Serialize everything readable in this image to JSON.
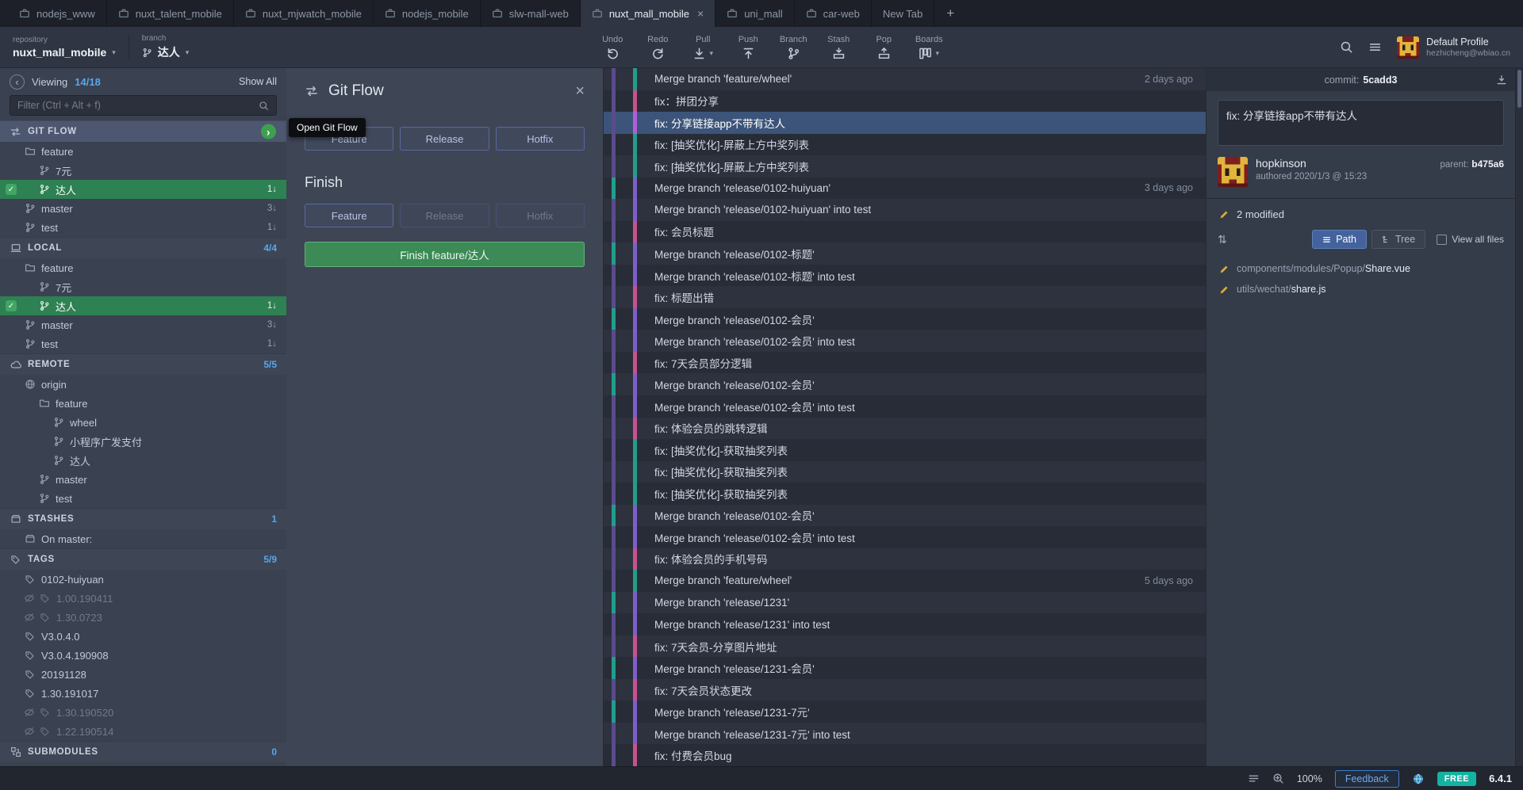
{
  "icons": {
    "check": "✓",
    "chevron_right": "›",
    "collapse": "‹",
    "close": "×",
    "caret": "▾",
    "sort": "⇅",
    "add_tab": "+"
  },
  "tabs": [
    {
      "label": "nodejs_www"
    },
    {
      "label": "nuxt_talent_mobile"
    },
    {
      "label": "nuxt_mjwatch_mobile"
    },
    {
      "label": "nodejs_mobile"
    },
    {
      "label": "slw-mall-web"
    },
    {
      "label": "nuxt_mall_mobile",
      "cls": "active",
      "close": "×"
    },
    {
      "label": "uni_mall"
    },
    {
      "label": "car-web"
    },
    {
      "label": "New Tab",
      "cls": "noicon"
    }
  ],
  "toolbar": {
    "repository_label": "repository",
    "repository_value": "nuxt_mall_mobile",
    "branch_label": "branch",
    "branch_value": "达人",
    "actions": [
      {
        "label": "Undo"
      },
      {
        "label": "Redo"
      },
      {
        "label": "Pull"
      },
      {
        "label": "Push"
      },
      {
        "label": "Branch"
      },
      {
        "label": "Stash"
      },
      {
        "label": "Pop"
      },
      {
        "label": "Boards"
      }
    ],
    "profile_name": "Default Profile",
    "profile_email": "hezhicheng@wbiao.cn"
  },
  "sidebar": {
    "viewing_label": "Viewing",
    "viewing_count": "14/18",
    "show_all": "Show All",
    "filter_placeholder": "Filter (Ctrl + Alt + f)",
    "rows": [
      {
        "label": "GIT FLOW",
        "cls": "header icon-gitflow gitflow-row"
      },
      {
        "label": "feature",
        "cls": "item icon-folder ind1"
      },
      {
        "label": "7元",
        "cls": "item icon-branch ind2"
      },
      {
        "label": "达人",
        "cls": "item icon-branch ind2 checked",
        "badge": "1↓"
      },
      {
        "label": "master",
        "cls": "item icon-branch ind1",
        "badge": "3↓"
      },
      {
        "label": "test",
        "cls": "item icon-branch ind1",
        "badge": "1↓"
      },
      {
        "label": "LOCAL",
        "count": "4/4",
        "cls": "header icon-laptop"
      },
      {
        "label": "feature",
        "cls": "item icon-folder ind1"
      },
      {
        "label": "7元",
        "cls": "item icon-branch ind2"
      },
      {
        "label": "达人",
        "cls": "item icon-branch ind2 checked",
        "badge": "1↓"
      },
      {
        "label": "master",
        "cls": "item icon-branch ind1",
        "badge": "3↓"
      },
      {
        "label": "test",
        "cls": "item icon-branch ind1",
        "badge": "1↓"
      },
      {
        "label": "REMOTE",
        "count": "5/5",
        "cls": "header icon-cloud"
      },
      {
        "label": "origin",
        "cls": "item icon-globe ind1"
      },
      {
        "label": "feature",
        "cls": "item icon-folder ind2"
      },
      {
        "label": "wheel",
        "cls": "item icon-branch ind3"
      },
      {
        "label": "小程序广发支付",
        "cls": "item icon-branch ind3"
      },
      {
        "label": "达人",
        "cls": "item icon-branch ind3"
      },
      {
        "label": "master",
        "cls": "item icon-branch ind2"
      },
      {
        "label": "test",
        "cls": "item icon-branch ind2"
      },
      {
        "label": "STASHES",
        "count": "1",
        "cls": "header icon-stash"
      },
      {
        "label": "On master:",
        "cls": "item icon-stash ind1"
      },
      {
        "label": "TAGS",
        "count": "5/9",
        "cls": "header icon-tag"
      },
      {
        "label": "0102-huiyuan",
        "cls": "item icon-tag ind1"
      },
      {
        "label": "1.00.190411",
        "cls": "item icon-tag ind1 dim"
      },
      {
        "label": "1.30.0723",
        "cls": "item icon-tag ind1 dim"
      },
      {
        "label": "V3.0.4.0",
        "cls": "item icon-tag ind1"
      },
      {
        "label": "V3.0.4.190908",
        "cls": "item icon-tag ind1"
      },
      {
        "label": "20191128",
        "cls": "item icon-tag ind1"
      },
      {
        "label": "1.30.191017",
        "cls": "item icon-tag ind1"
      },
      {
        "label": "1.30.190520",
        "cls": "item icon-tag ind1 dim"
      },
      {
        "label": "1.22.190514",
        "cls": "item icon-tag ind1 dim"
      },
      {
        "label": "SUBMODULES",
        "count": "0",
        "cls": "header icon-sub"
      }
    ]
  },
  "gitflow": {
    "title": "Git Flow",
    "start_buttons": [
      {
        "label": "Feature"
      },
      {
        "label": "Release"
      },
      {
        "label": "Hotfix"
      }
    ],
    "finish_title": "Finish",
    "finish_buttons": [
      {
        "label": "Feature"
      },
      {
        "label": "Release",
        "cls": "disabled"
      },
      {
        "label": "Hotfix",
        "cls": "disabled"
      }
    ],
    "finish_action": "Finish feature/达人",
    "tooltip": "Open Git Flow"
  },
  "graph": {
    "rows": [
      {
        "message": "Merge branch 'feature/wheel'",
        "date": "2 days ago",
        "c1": "#5b4b8e",
        "c2": "#219e8b"
      },
      {
        "message": "fix：拼团分享",
        "c1": "#5b4b8e",
        "c2": "#c9518f"
      },
      {
        "message": "fix: 分享链接app不带有达人",
        "cls": "selected",
        "c1": "#5b4b8e",
        "c2": "#b05fd6"
      },
      {
        "message": "fix: [抽奖优化]-屏蔽上方中奖列表",
        "c1": "#5b4b8e",
        "c2": "#219e8b"
      },
      {
        "message": "fix: [抽奖优化]-屏蔽上方中奖列表",
        "c1": "#5b4b8e",
        "c2": "#219e8b"
      },
      {
        "message": "Merge branch 'release/0102-huiyuan'",
        "date": "3 days ago",
        "c1": "#219e8b",
        "c2": "#7c5fc9"
      },
      {
        "message": "Merge branch 'release/0102-huiyuan' into test",
        "c1": "#5b4b8e",
        "c2": "#7c5fc9"
      },
      {
        "message": "fix: 会员标题",
        "c1": "#5b4b8e",
        "c2": "#c9518f"
      },
      {
        "message": "Merge branch 'release/0102-标题'",
        "c1": "#219e8b",
        "c2": "#7c5fc9"
      },
      {
        "message": "Merge branch 'release/0102-标题' into test",
        "c1": "#5b4b8e",
        "c2": "#7c5fc9"
      },
      {
        "message": "fix: 标题出错",
        "c1": "#5b4b8e",
        "c2": "#c9518f"
      },
      {
        "message": "Merge branch 'release/0102-会员'",
        "c1": "#219e8b",
        "c2": "#7c5fc9"
      },
      {
        "message": "Merge branch 'release/0102-会员' into test",
        "c1": "#5b4b8e",
        "c2": "#7c5fc9"
      },
      {
        "message": "fix: 7天会员部分逻辑",
        "c1": "#5b4b8e",
        "c2": "#c9518f"
      },
      {
        "message": "Merge branch 'release/0102-会员'",
        "c1": "#219e8b",
        "c2": "#7c5fc9"
      },
      {
        "message": "Merge branch 'release/0102-会员' into test",
        "c1": "#5b4b8e",
        "c2": "#7c5fc9"
      },
      {
        "message": "fix: 体验会员的跳转逻辑",
        "c1": "#5b4b8e",
        "c2": "#c9518f"
      },
      {
        "message": "fix: [抽奖优化]-获取抽奖列表",
        "c1": "#5b4b8e",
        "c2": "#219e8b"
      },
      {
        "message": "fix: [抽奖优化]-获取抽奖列表",
        "c1": "#5b4b8e",
        "c2": "#219e8b"
      },
      {
        "message": "fix: [抽奖优化]-获取抽奖列表",
        "c1": "#5b4b8e",
        "c2": "#219e8b"
      },
      {
        "message": "Merge branch 'release/0102-会员'",
        "c1": "#219e8b",
        "c2": "#7c5fc9"
      },
      {
        "message": "Merge branch 'release/0102-会员' into test",
        "c1": "#5b4b8e",
        "c2": "#7c5fc9"
      },
      {
        "message": "fix: 体验会员的手机号码",
        "c1": "#5b4b8e",
        "c2": "#c9518f"
      },
      {
        "message": "Merge branch 'feature/wheel'",
        "date": "5 days ago",
        "c1": "#5b4b8e",
        "c2": "#219e8b"
      },
      {
        "message": "Merge branch 'release/1231'",
        "c1": "#219e8b",
        "c2": "#7c5fc9"
      },
      {
        "message": "Merge branch 'release/1231' into test",
        "c1": "#5b4b8e",
        "c2": "#7c5fc9"
      },
      {
        "message": "fix: 7天会员-分享图片地址",
        "c1": "#5b4b8e",
        "c2": "#c9518f"
      },
      {
        "message": "Merge branch 'release/1231-会员'",
        "c1": "#219e8b",
        "c2": "#7c5fc9"
      },
      {
        "message": "fix: 7天会员状态更改",
        "c1": "#5b4b8e",
        "c2": "#c9518f"
      },
      {
        "message": "Merge branch 'release/1231-7元'",
        "c1": "#219e8b",
        "c2": "#7c5fc9"
      },
      {
        "message": "Merge branch 'release/1231-7元' into test",
        "c1": "#5b4b8e",
        "c2": "#7c5fc9"
      },
      {
        "message": "fix: 付费会员bug",
        "c1": "#5b4b8e",
        "c2": "#c9518f"
      }
    ]
  },
  "commit": {
    "header_label": "commit:",
    "hash": "5cadd3",
    "message": "fix: 分享链接app不带有达人",
    "author": "hopkinson",
    "parent_label": "parent:",
    "parent_hash": "b475a6",
    "authored": "authored 2020/1/3 @ 15:23",
    "modified": "2 modified",
    "path_label": "Path",
    "tree_label": "Tree",
    "view_all_label": "View all files",
    "files": [
      {
        "dir": "components/modules/Popup/",
        "name": "Share.vue"
      },
      {
        "dir": "utils/wechat/",
        "name": "share.js"
      }
    ]
  },
  "statusbar": {
    "zoom": "100%",
    "feedback": "Feedback",
    "free": "FREE",
    "version": "6.4.1"
  },
  "colors": {
    "accent_blue": "#58a7ea",
    "checked_green": "#2e8152",
    "selected_row": "#3c5479",
    "free_badge": "#14b2a1"
  }
}
